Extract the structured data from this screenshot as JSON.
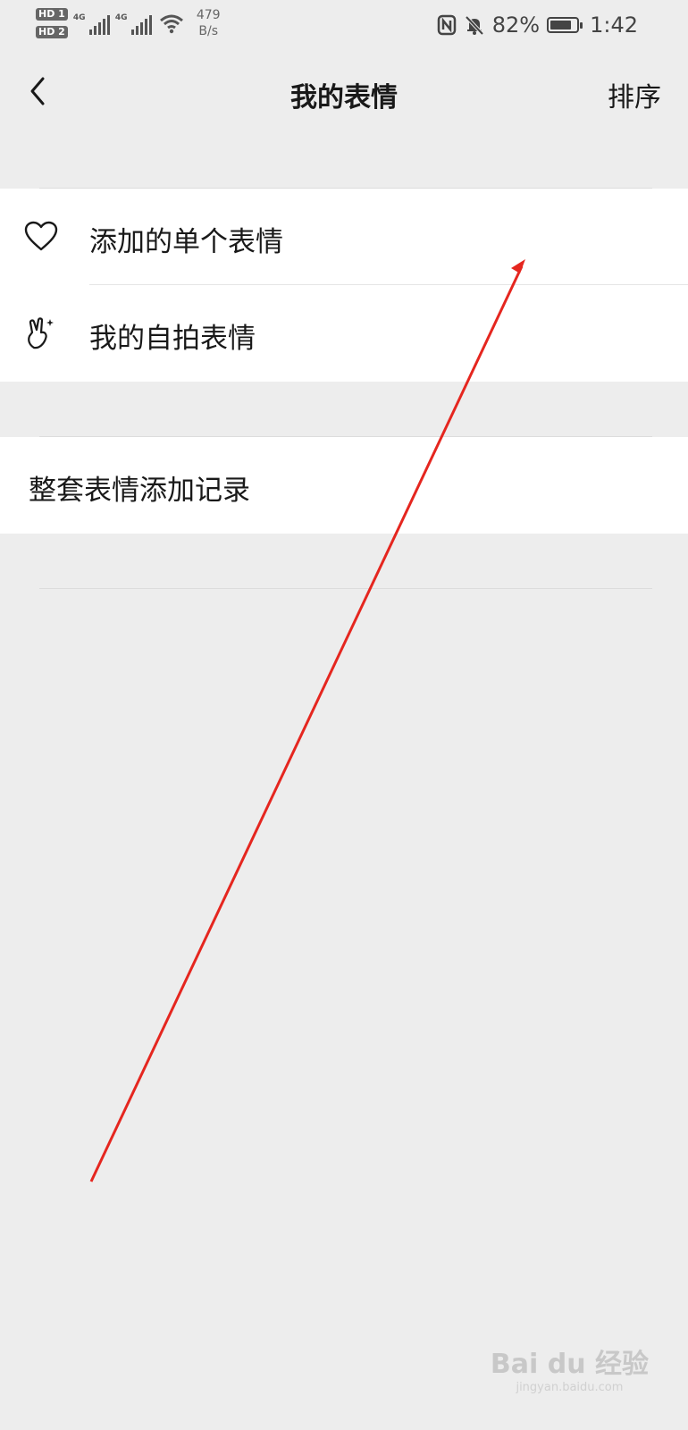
{
  "status_bar": {
    "hd1": "HD 1",
    "hd2": "HD 2",
    "network": "4G",
    "network2": "4G",
    "speed_value": "479",
    "speed_unit": "B/s",
    "nfc_icon": "nfc-icon",
    "mute_icon": "bell-off-icon",
    "battery_percent": "82%",
    "battery_level": 0.82,
    "time": "1:42"
  },
  "nav": {
    "back_icon": "chevron-left-icon",
    "title": "我的表情",
    "sort_label": "排序"
  },
  "list1": [
    {
      "icon": "heart-icon",
      "label": "添加的单个表情"
    },
    {
      "icon": "selfie-hand-icon",
      "label": "我的自拍表情"
    }
  ],
  "list2": [
    {
      "label": "整套表情添加记录"
    }
  ],
  "annotation": {
    "arrow_color": "#e5261f"
  },
  "watermark": {
    "text": "Bai du 经验",
    "sub": "jingyan.baidu.com"
  }
}
